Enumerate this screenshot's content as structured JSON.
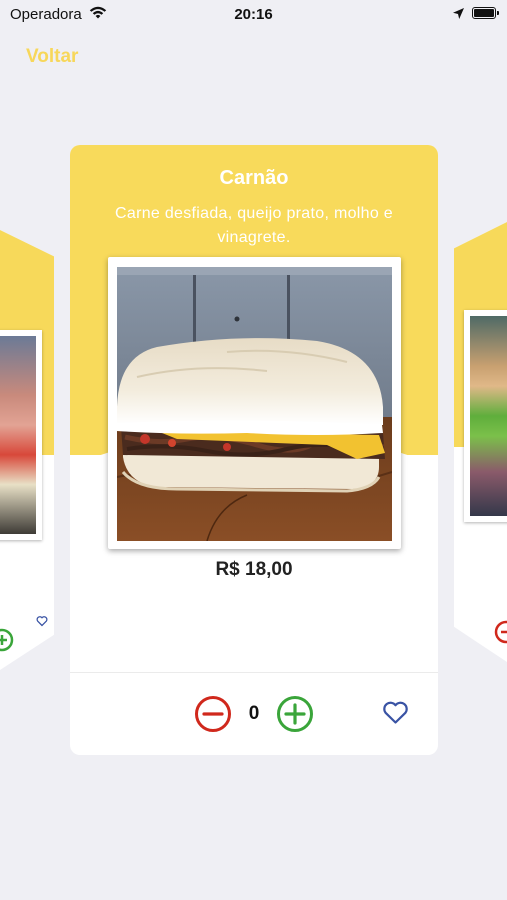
{
  "status_bar": {
    "carrier": "Operadora",
    "time": "20:16"
  },
  "nav": {
    "back_label": "Voltar"
  },
  "product": {
    "name": "Carnão",
    "description": "Carne desfiada, queijo prato, molho e vinagrete.",
    "price": "R$ 18,00",
    "quantity": "0"
  },
  "colors": {
    "accent": "#f8da5b",
    "minus": "#d0281c",
    "plus": "#3aa53a",
    "heart": "#3953a4"
  },
  "icons": {
    "minus": "minus-circle-icon",
    "plus": "plus-circle-icon",
    "favorite": "heart-icon"
  }
}
